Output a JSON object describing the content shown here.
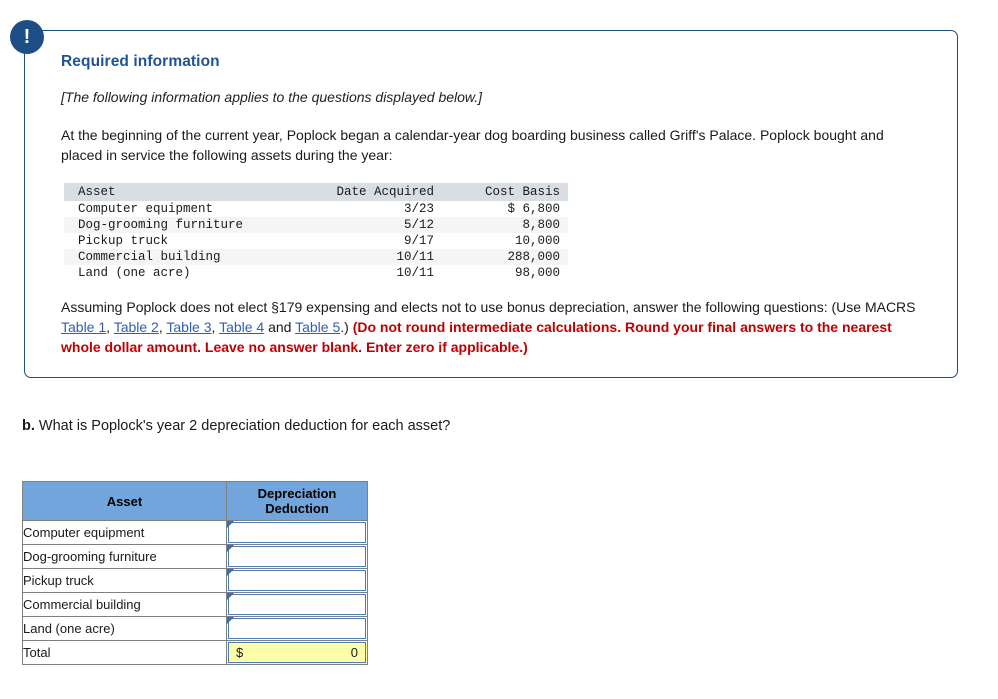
{
  "alert": {
    "icon": "exclamation-icon",
    "glyph": "!"
  },
  "panel": {
    "title": "Required information",
    "italic_note": "[The following information applies to the questions displayed below.]",
    "intro_paragraph": "At the beginning of the current year, Poplock began a calendar-year dog boarding business called Griff's Palace. Poplock bought and placed in service the following assets during the year:",
    "asset_table": {
      "headers": [
        "Asset",
        "Date Acquired",
        "Cost Basis"
      ],
      "rows": [
        {
          "asset": "Computer equipment",
          "date": "3/23",
          "cost": "$ 6,800"
        },
        {
          "asset": "Dog-grooming furniture",
          "date": "5/12",
          "cost": "8,800"
        },
        {
          "asset": "Pickup truck",
          "date": "9/17",
          "cost": "10,000"
        },
        {
          "asset": "Commercial building",
          "date": "10/11",
          "cost": "288,000"
        },
        {
          "asset": "Land (one acre)",
          "date": "10/11",
          "cost": "98,000"
        }
      ]
    },
    "macrs": {
      "lead": "Assuming Poplock does not elect §179 expensing and elects not to use bonus depreciation, answer the following questions: (Use MACRS ",
      "link1": "Table 1",
      "sep1": ", ",
      "link2": "Table 2",
      "sep2": ", ",
      "link3": "Table 3",
      "sep3": ", ",
      "link4": "Table 4",
      "sep4": " and ",
      "link5": "Table 5",
      "close": ".) ",
      "warning": "(Do not round intermediate calculations. Round your final answers to the nearest whole dollar amount. Leave no answer blank. Enter zero if applicable.)"
    }
  },
  "question": {
    "label": "b.",
    "text": " What is Poplock's year 2 depreciation deduction for each asset?"
  },
  "answer_table": {
    "headers": {
      "asset": "Asset",
      "deduction_line1": "Depreciation",
      "deduction_line2": "Deduction"
    },
    "rows": [
      {
        "asset": "Computer equipment",
        "value": ""
      },
      {
        "asset": "Dog-grooming furniture",
        "value": ""
      },
      {
        "asset": "Pickup truck",
        "value": ""
      },
      {
        "asset": "Commercial building",
        "value": ""
      },
      {
        "asset": "Land (one acre)",
        "value": ""
      }
    ],
    "total": {
      "label": "Total",
      "currency": "$",
      "value": "0"
    }
  },
  "colors": {
    "panel_border": "#1f4e79",
    "badge": "#1d4e86",
    "title_blue": "#1f5395",
    "link_blue": "#2f5fb3",
    "warning_red": "#c00000",
    "header_blue": "#73a5dd",
    "input_border": "#4a7ebb",
    "total_yellow": "#ffffaa",
    "mono_header_gray": "#d9dde4"
  }
}
